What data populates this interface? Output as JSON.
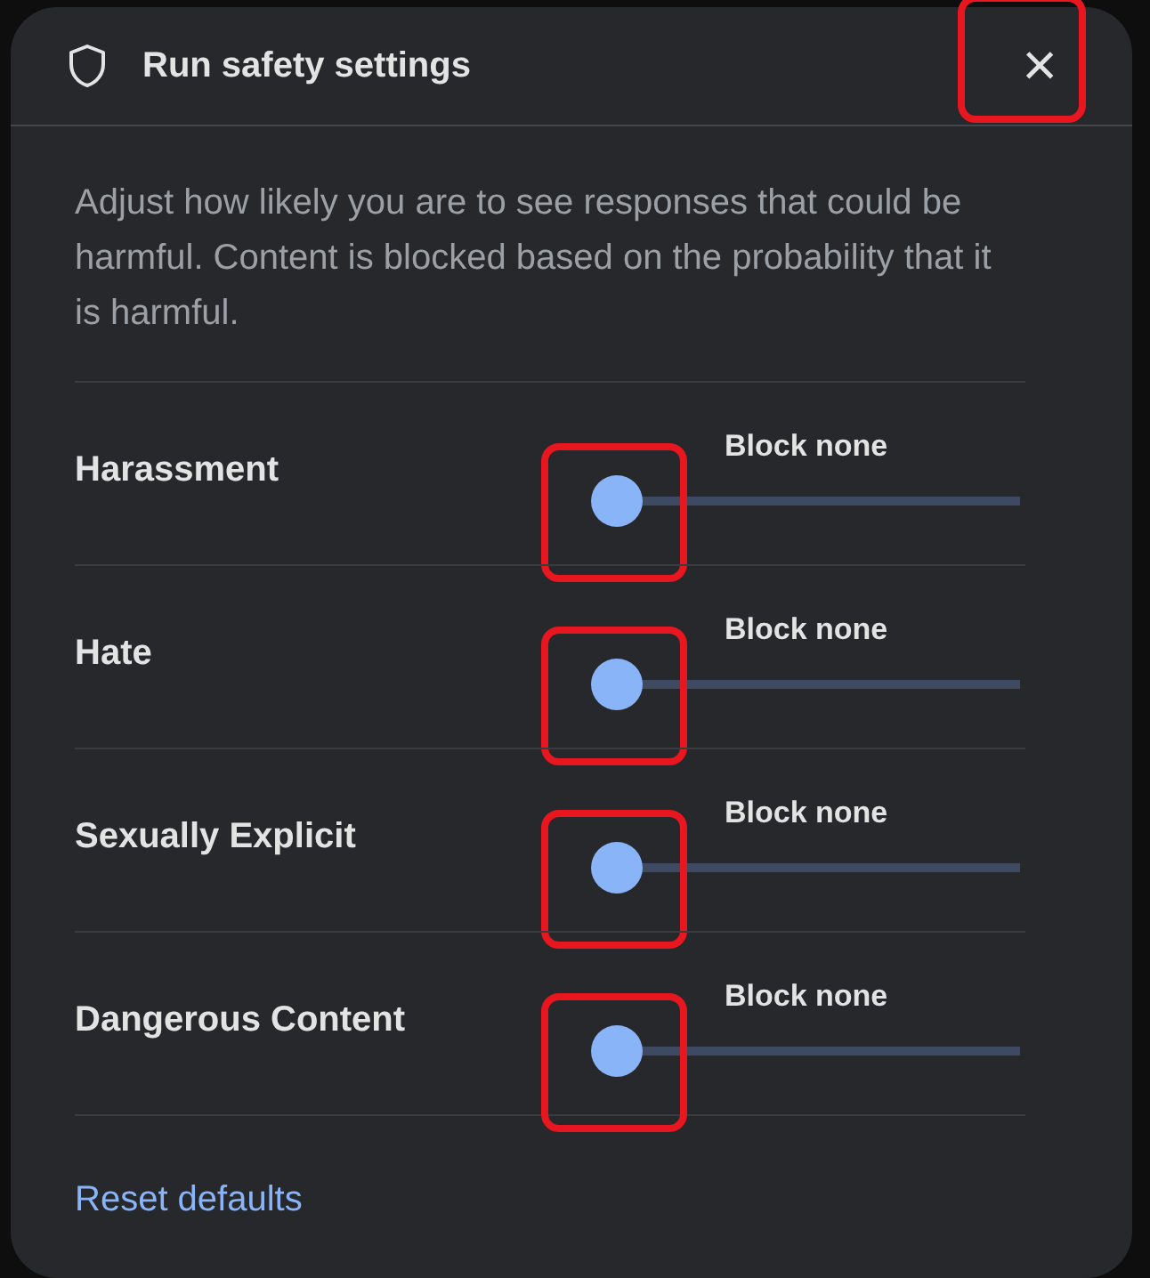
{
  "dialog": {
    "title": "Run safety settings",
    "close": {
      "label": "×",
      "highlighted": true
    }
  },
  "description": "Adjust how likely you are to see responses that could be harmful. Content is blocked based on the probability that it is harmful.",
  "settings": [
    {
      "name": "Harassment",
      "reading": "Block none",
      "level": 0,
      "highlighted": true
    },
    {
      "name": "Hate",
      "reading": "Block none",
      "level": 0,
      "highlighted": true
    },
    {
      "name": "Sexually Explicit",
      "reading": "Block none",
      "level": 0,
      "highlighted": true
    },
    {
      "name": "Dangerous Content",
      "reading": "Block none",
      "level": 0,
      "highlighted": true
    }
  ],
  "reset_link": "Reset defaults"
}
